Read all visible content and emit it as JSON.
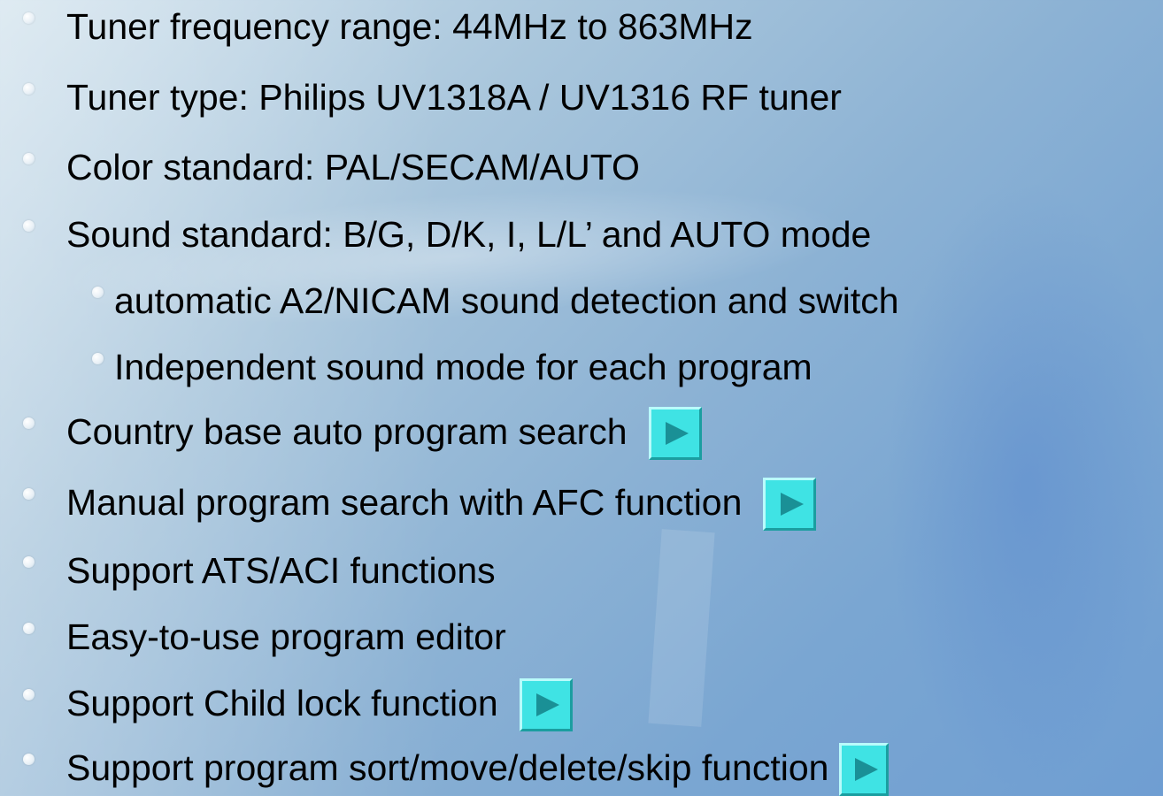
{
  "colors": {
    "text": "#000000",
    "bullet": "#ffffff",
    "button_face": "#3fe3e4",
    "button_arrow": "#1a9096"
  },
  "items": [
    {
      "text": "Tuner frequency range: 44MHz to 863MHz"
    },
    {
      "text": "Tuner type: Philips UV1318A / UV1316 RF tuner"
    },
    {
      "text": "Color standard: PAL/SECAM/AUTO"
    },
    {
      "text": "Sound standard:  B/G, D/K, I, L/L’ and AUTO mode"
    },
    {
      "text": "automatic A2/NICAM sound detection and switch"
    },
    {
      "text": "Independent sound mode for each program"
    },
    {
      "text": "Country base auto program search",
      "action_icon": "play-icon"
    },
    {
      "text": "Manual program search with AFC function",
      "action_icon": "play-icon"
    },
    {
      "text": "Support ATS/ACI functions"
    },
    {
      "text": "Easy-to-use program editor"
    },
    {
      "text": "Support Child lock function",
      "action_icon": "play-icon"
    },
    {
      "text": "Support program sort/move/delete/skip function",
      "action_icon": "play-icon"
    }
  ]
}
